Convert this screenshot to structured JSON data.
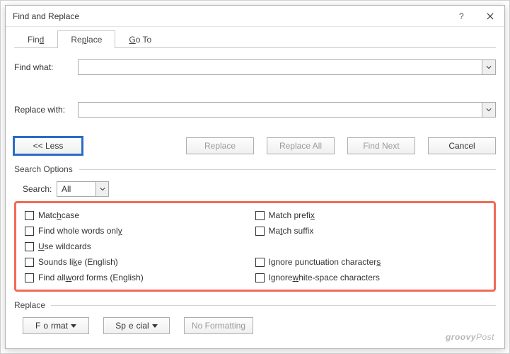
{
  "title": "Find and Replace",
  "tabs": {
    "find": "Find",
    "replace": "Replace",
    "goto": "Go To",
    "find_ul": "d",
    "replace_ul": "P",
    "goto_ul": "G"
  },
  "fields": {
    "find_label": "Find what:",
    "find_value": "",
    "replace_label": "Replace with:",
    "replace_value": ""
  },
  "buttons": {
    "less": "<< Less",
    "replace": "Replace",
    "replace_all": "Replace All",
    "find_next": "Find Next",
    "cancel": "Cancel"
  },
  "search_options_label": "Search Options",
  "search_label": "Search:",
  "search_value": "All",
  "checks": {
    "match_case": "Match case",
    "whole_words": "Find whole words only",
    "wildcards": "Use wildcards",
    "sounds_like": "Sounds like (English)",
    "word_forms": "Find all word forms (English)",
    "match_prefix": "Match prefix",
    "match_suffix": "Match suffix",
    "ignore_punct": "Ignore punctuation characters",
    "ignore_ws": "Ignore white-space characters"
  },
  "replace_section_label": "Replace",
  "format_buttons": {
    "format": "Format",
    "special": "Special",
    "no_formatting": "No Formatting"
  },
  "watermark": {
    "brand": "groovy",
    "suffix": "Post"
  }
}
